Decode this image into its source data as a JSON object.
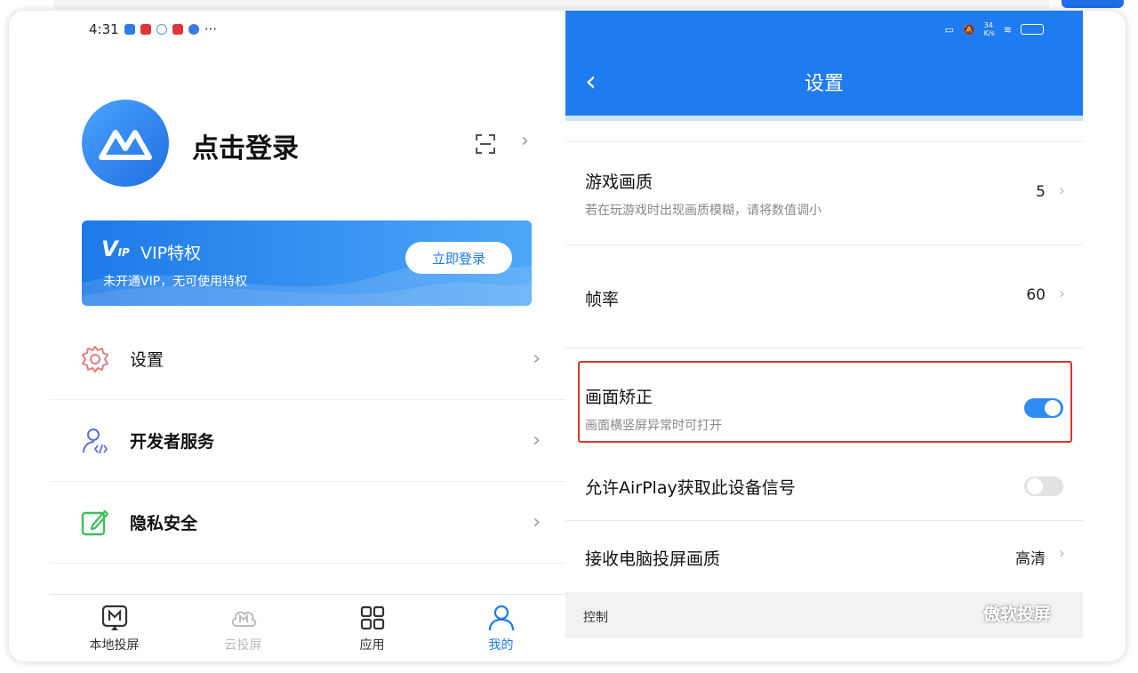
{
  "status_bar": {
    "time": "4:31",
    "more": "···"
  },
  "profile": {
    "login_text": "点击登录"
  },
  "vip": {
    "logo": "V",
    "logo_sub": "IP",
    "title": "VIP特权",
    "subtitle": "未开通VIP，无可使用特权",
    "button": "立即登录"
  },
  "menu": [
    {
      "label": "设置",
      "icon": "gear-icon"
    },
    {
      "label": "开发者服务",
      "icon": "developer-icon"
    },
    {
      "label": "隐私安全",
      "icon": "edit-shield-icon"
    }
  ],
  "tabs": [
    {
      "label": "本地投屏",
      "icon": "local-cast-icon",
      "state": "normal"
    },
    {
      "label": "云投屏",
      "icon": "cloud-cast-icon",
      "state": "disabled"
    },
    {
      "label": "应用",
      "icon": "apps-grid-icon",
      "state": "normal"
    },
    {
      "label": "我的",
      "icon": "user-icon",
      "state": "active"
    }
  ],
  "settings": {
    "title": "设置",
    "status_speed": "34",
    "status_unit": "K/s",
    "rows": {
      "game_quality": {
        "title": "游戏画质",
        "subtitle": "若在玩游戏时出现画质模糊，请将数值调小",
        "value": "5"
      },
      "frame_rate": {
        "title": "帧率",
        "value": "60"
      },
      "screen_correction": {
        "title": "画面矫正",
        "subtitle": "画面横竖屏异常时可打开",
        "toggle": "on"
      },
      "airplay": {
        "title": "允许AirPlay获取此设备信号",
        "toggle": "off"
      },
      "pc_quality": {
        "title": "接收电脑投屏画质",
        "value": "高清"
      }
    },
    "section_label": "控制"
  },
  "watermark": "傲软投屏",
  "colors": {
    "primary": "#1f7cf0",
    "highlight": "#d6392f",
    "toggle_on": "#2f8cf0"
  }
}
